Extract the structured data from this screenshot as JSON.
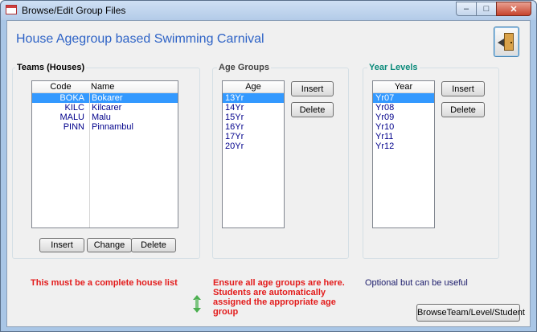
{
  "window": {
    "title": "Browse/Edit Group Files",
    "minimize": "–",
    "maximize": "□",
    "close": "✕"
  },
  "header": {
    "title": "House Agegroup based Swimming Carnival"
  },
  "teams": {
    "title": "Teams (Houses)",
    "columns": [
      "Code",
      "Name"
    ],
    "rows": [
      {
        "code": "BOKA",
        "name": "Bokarer"
      },
      {
        "code": "KILC",
        "name": "Kilcarer"
      },
      {
        "code": "MALU",
        "name": "Malu"
      },
      {
        "code": "PINN",
        "name": "Pinnambul"
      }
    ],
    "buttons": {
      "insert": "Insert",
      "change": "Change",
      "delete": "Delete"
    },
    "note": "This must be a complete house list"
  },
  "age_groups": {
    "title": "Age Groups",
    "column": "Age",
    "items": [
      "13Yr",
      "14Yr",
      "15Yr",
      "16Yr",
      "17Yr",
      "20Yr"
    ],
    "buttons": {
      "insert": "Insert",
      "delete": "Delete"
    },
    "note_line1": "Ensure all age groups are here.",
    "note_line2": "Students are automatically",
    "note_line3": "assigned the appropriate age",
    "note_line4": "group"
  },
  "year_levels": {
    "title": "Year Levels",
    "column": "Year",
    "items": [
      "Yr07",
      "Yr08",
      "Yr09",
      "Yr10",
      "Yr11",
      "Yr12"
    ],
    "buttons": {
      "insert": "Insert",
      "delete": "Delete"
    },
    "note": "Optional but can be useful"
  },
  "browse_button": "BrowseTeam/Level/Student",
  "colors": {
    "accent_title": "#2e63c6",
    "note_red": "#e31b1b",
    "year_title": "#0a8a7a",
    "selection": "#3399ff"
  }
}
